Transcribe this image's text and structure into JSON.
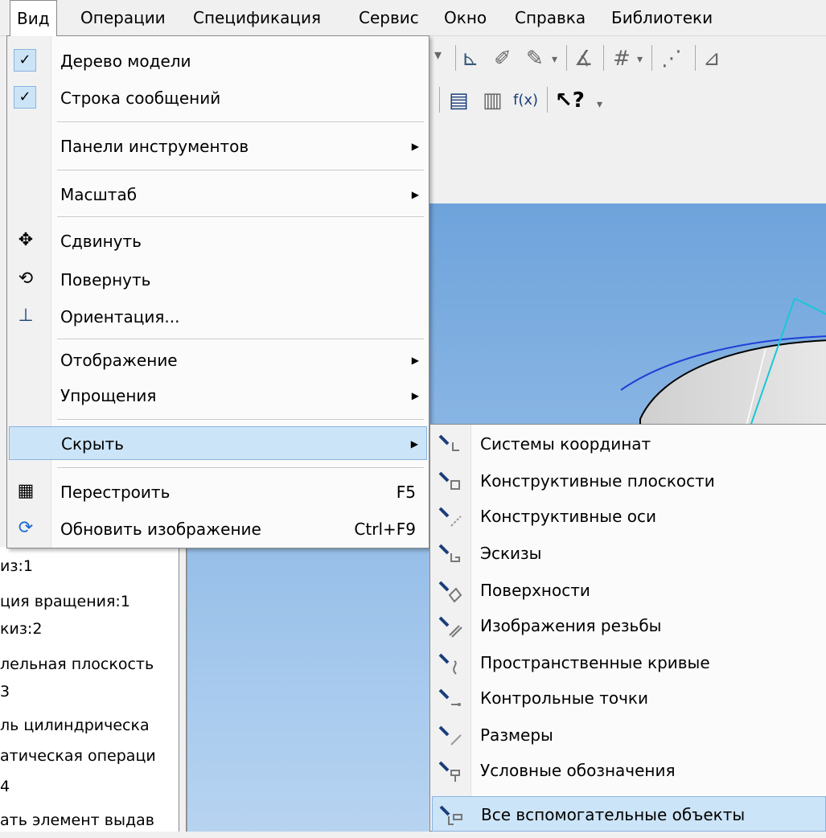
{
  "menubar": {
    "items": [
      {
        "label": "Вид"
      },
      {
        "label": "Операции"
      },
      {
        "label": "Спецификация"
      },
      {
        "label": "Сервис"
      },
      {
        "label": "Окно"
      },
      {
        "label": "Справка"
      },
      {
        "label": "Библиотеки"
      }
    ]
  },
  "toolbar": {
    "help_text": "f(x)",
    "help_q": "?"
  },
  "view_menu": {
    "model_tree": "Дерево модели",
    "message_bar": "Строка сообщений",
    "toolbars": "Панели инструментов",
    "scale": "Масштаб",
    "pan": "Сдвинуть",
    "rotate": "Повернуть",
    "orientation": "Ориентация...",
    "display": "Отображение",
    "simplify": "Упрощения",
    "hide": "Скрыть",
    "rebuild": "Перестроить",
    "rebuild_shortcut": "F5",
    "refresh": "Обновить изображение",
    "refresh_shortcut": "Ctrl+F9"
  },
  "hide_submenu": {
    "items": [
      {
        "label": "Системы координат"
      },
      {
        "label": "Конструктивные плоскости"
      },
      {
        "label": "Конструктивные оси"
      },
      {
        "label": "Эскизы"
      },
      {
        "label": "Поверхности"
      },
      {
        "label": "Изображения резьбы"
      },
      {
        "label": "Пространственные кривые"
      },
      {
        "label": "Контрольные точки"
      },
      {
        "label": "Размеры"
      },
      {
        "label": "Условные обозначения"
      },
      {
        "label": "Все вспомогательные объекты"
      }
    ]
  },
  "tree_panel": {
    "lines": [
      "из:1",
      "ция вращения:1",
      "киз:2",
      "лельная плоскость",
      "3",
      "ль цилиндрическа",
      "атическая операци",
      "4",
      "ать элемент выдав"
    ]
  },
  "colors": {
    "highlight": "#cce4f7",
    "highlight_border": "#8ab4df",
    "viewport": "#6ea3db"
  }
}
